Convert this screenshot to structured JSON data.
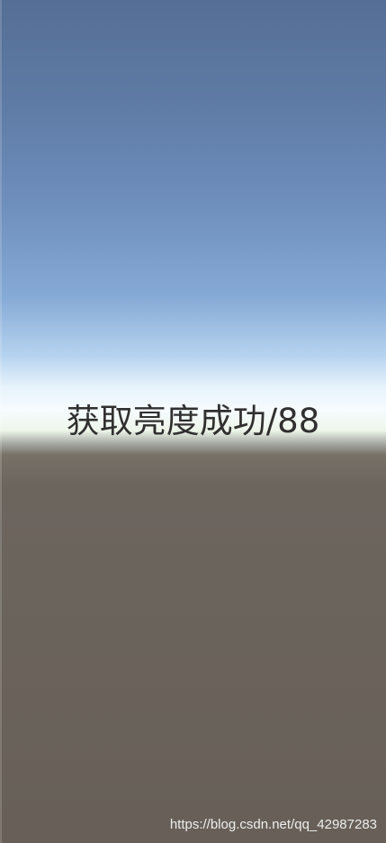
{
  "screen": {
    "status_message": "获取亮度成功/88",
    "watermark": "https://blog.csdn.net/qq_42987283"
  },
  "colors": {
    "sky_top": "#556e95",
    "horizon_light": "#f6fbff",
    "ground": "#686058",
    "status_text": "#303030",
    "watermark_text": "#f5f5f5"
  }
}
